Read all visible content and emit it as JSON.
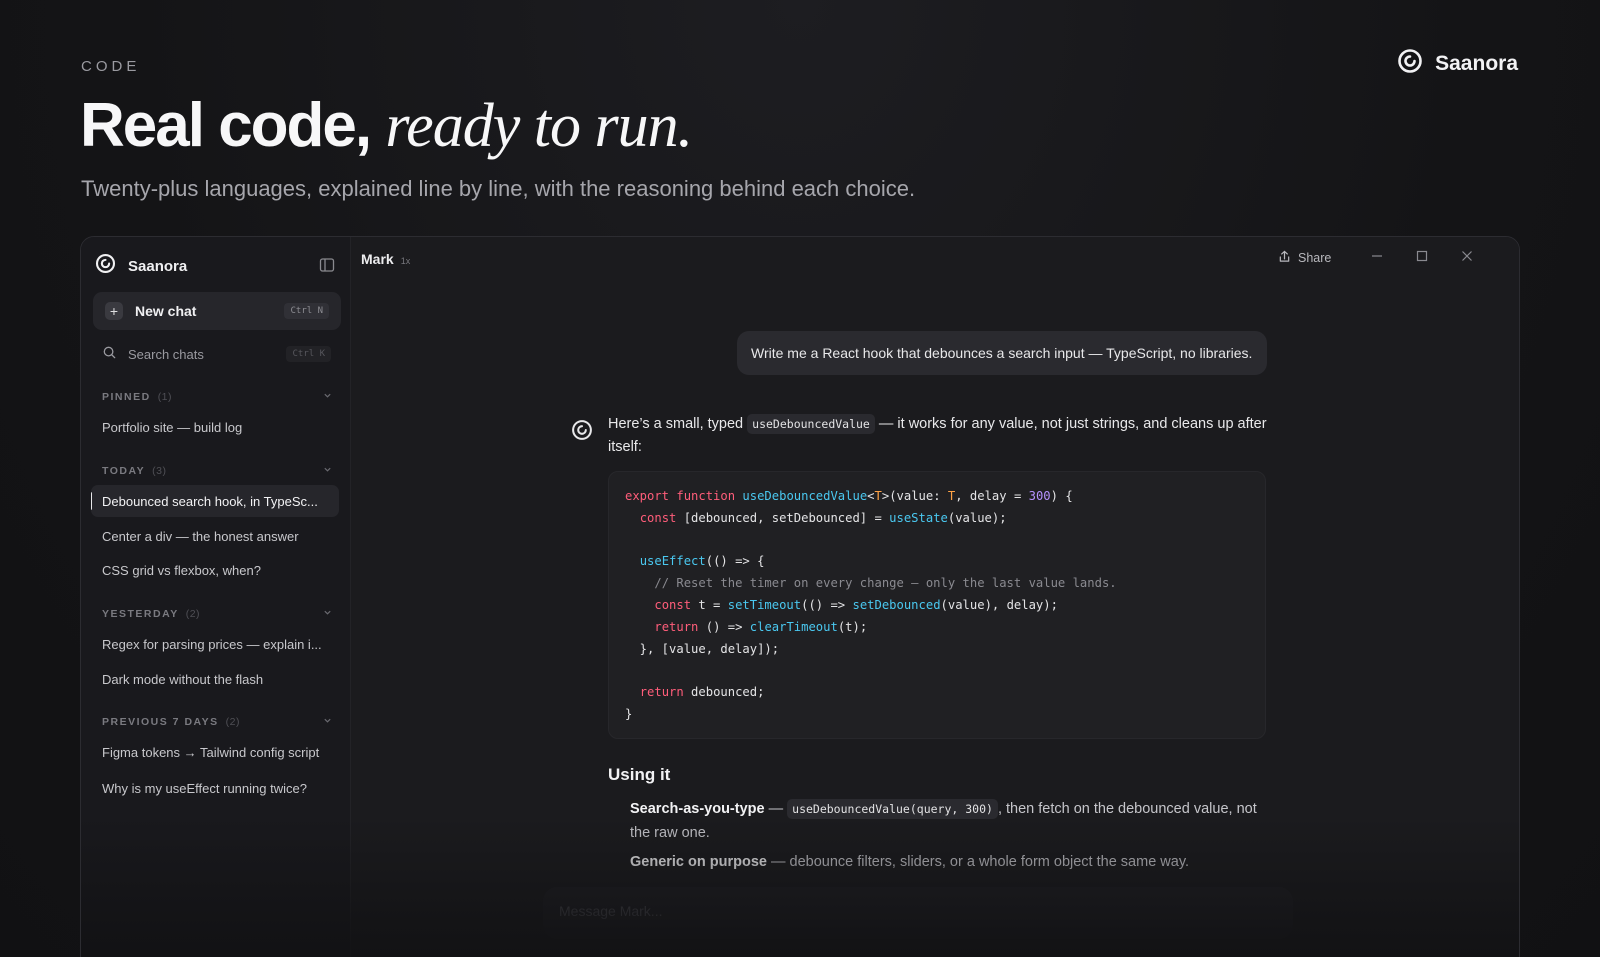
{
  "hero": {
    "eyebrow": "CODE",
    "title_bold": "Real code,",
    "title_italic": "ready to run.",
    "subtitle": "Twenty-plus languages, explained line by line, with the reasoning behind each choice."
  },
  "brand": {
    "name": "Saanora",
    "icon": "spiral-logo-icon"
  },
  "sidebar": {
    "app_name": "Saanora",
    "new_chat": {
      "label": "New chat",
      "shortcut": "Ctrl N"
    },
    "search": {
      "placeholder": "Search chats",
      "shortcut": "Ctrl K"
    },
    "sections": [
      {
        "label": "PINNED",
        "count": "(1)",
        "items": [
          "Portfolio site — build log"
        ]
      },
      {
        "label": "TODAY",
        "count": "(3)",
        "items": [
          "Debounced search hook, in TypeSc...",
          "Center a div — the honest answer",
          "CSS grid vs flexbox, when?"
        ]
      },
      {
        "label": "YESTERDAY",
        "count": "(2)",
        "items": [
          "Regex for parsing prices — explain i...",
          "Dark mode without the flash"
        ]
      },
      {
        "label": "PREVIOUS 7 DAYS",
        "count": "(2)",
        "items": [
          "Figma tokens → Tailwind config script",
          "Why is my useEffect running twice?"
        ]
      }
    ],
    "active_item": "Debounced search hook, in TypeSc..."
  },
  "topbar": {
    "model": "Mark",
    "multiplier": "1x",
    "share_label": "Share"
  },
  "conversation": {
    "user_message": "Write me a React hook that debounces a search input — TypeScript, no libraries.",
    "assistant_intro_before": "Here’s a small, typed",
    "assistant_intro_code": "useDebouncedValue",
    "assistant_intro_after": "— it works for any value, not just strings, and cleans up after itself:",
    "section_heading": "Using it",
    "bullets": [
      {
        "bold": "Search-as-you-type",
        "dash": " — ",
        "code": "useDebouncedValue(query, 300)",
        "after": ", then fetch on the debounced value, not the raw one."
      },
      {
        "bold": "Generic on purpose",
        "dash": " — ",
        "text": "debounce filters, sliders, or a whole form object the same way."
      }
    ],
    "composer_placeholder": "Message Mark..."
  },
  "colors": {
    "keyword": "#ff5d7a",
    "function": "#4ac8f0",
    "type": "#ffa246",
    "number": "#b592ff",
    "comment": "#8a8a90"
  }
}
